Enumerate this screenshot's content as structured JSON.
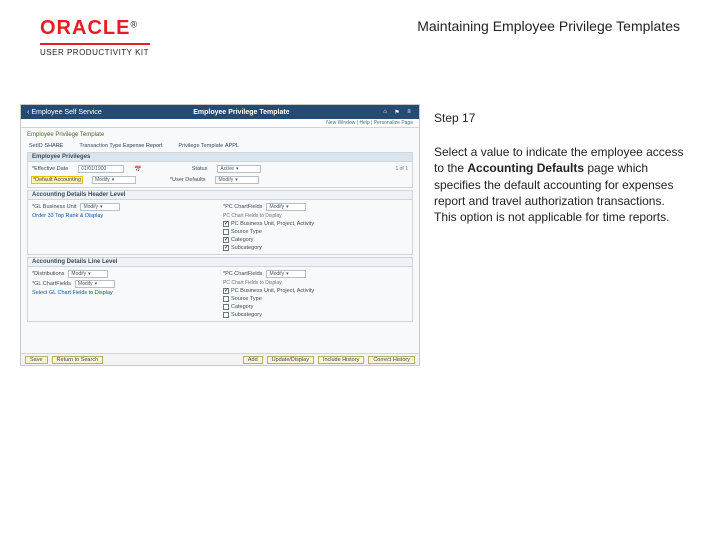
{
  "header": {
    "brand_word": "ORACLE",
    "brand_reg": "®",
    "product_line": "USER PRODUCTIVITY KIT",
    "doc_title": "Maintaining Employee Privilege Templates"
  },
  "instruction": {
    "step_label": "Step 17",
    "body_pre": "Select a value to indicate the employee access to the ",
    "body_bold": "Accounting Defaults",
    "body_post": " page which specifies the default accounting for expenses report and travel authorization transactions. This option is not applicable for time reports."
  },
  "shot": {
    "navbar": {
      "back_label": "Employee Self Service",
      "title": "Employee Privilege Template",
      "icon_home": "home-icon",
      "icon_flag": "flag-icon",
      "icon_menu": "menu-icon"
    },
    "subbar_text": "New Window | Help | Personalize Page",
    "crumb": "Employee Privilege Template",
    "top_row": {
      "setid_label": "SetID",
      "setid_value": "SHARE",
      "txn_label": "Transaction Type",
      "txn_value": "Expense Report",
      "ptpl_label": "Privilege Template",
      "ptpl_value": "APPL"
    },
    "privileges": {
      "section_title": "Employee Privileges",
      "eff_date_label": "*Effective Date",
      "eff_date_value": "01/01/1900",
      "status_label": "Status",
      "status_value": "Active",
      "counter": "1 of 1",
      "def_acct_label": "*Default Accounting",
      "def_acct_value": "Modify",
      "uj_label": "*User Defaults",
      "uj_value": "Modify"
    },
    "header_level": {
      "section_title": "Accounting Details   Header Level",
      "gl_label": "*GL Business Unit",
      "gl_value": "Modify",
      "pc_label": "*PC ChartFields",
      "pc_value": "Modify",
      "cfd_label": "PC Chart Fields to Display",
      "order_link": "Order 33 Top Rank & Display",
      "cf1": "PC Business Unit, Project, Activity",
      "cf2": "Source Type",
      "cf3": "Category",
      "cf4": "Subcategory"
    },
    "line_level": {
      "section_title": "Accounting Details   Line Level",
      "dist_label": "*Distributions",
      "dist_value": "Modify",
      "gl_label": "*GL ChartFields",
      "gl_value": "Modify",
      "pc_label": "*PC ChartFields",
      "pc_value": "Modify",
      "cfd_label": "PC Chart Fields to Display",
      "order_link": "Select GL Chart Fields to Display",
      "cf1": "PC Business Unit, Project, Activity",
      "cf2": "Source Type",
      "cf3": "Category",
      "cf4": "Subcategory"
    },
    "footer": {
      "save": "Save",
      "return": "Return to Search",
      "add": "Add",
      "upd": "Update/Display",
      "hist": "Include History",
      "corr": "Correct History"
    }
  }
}
